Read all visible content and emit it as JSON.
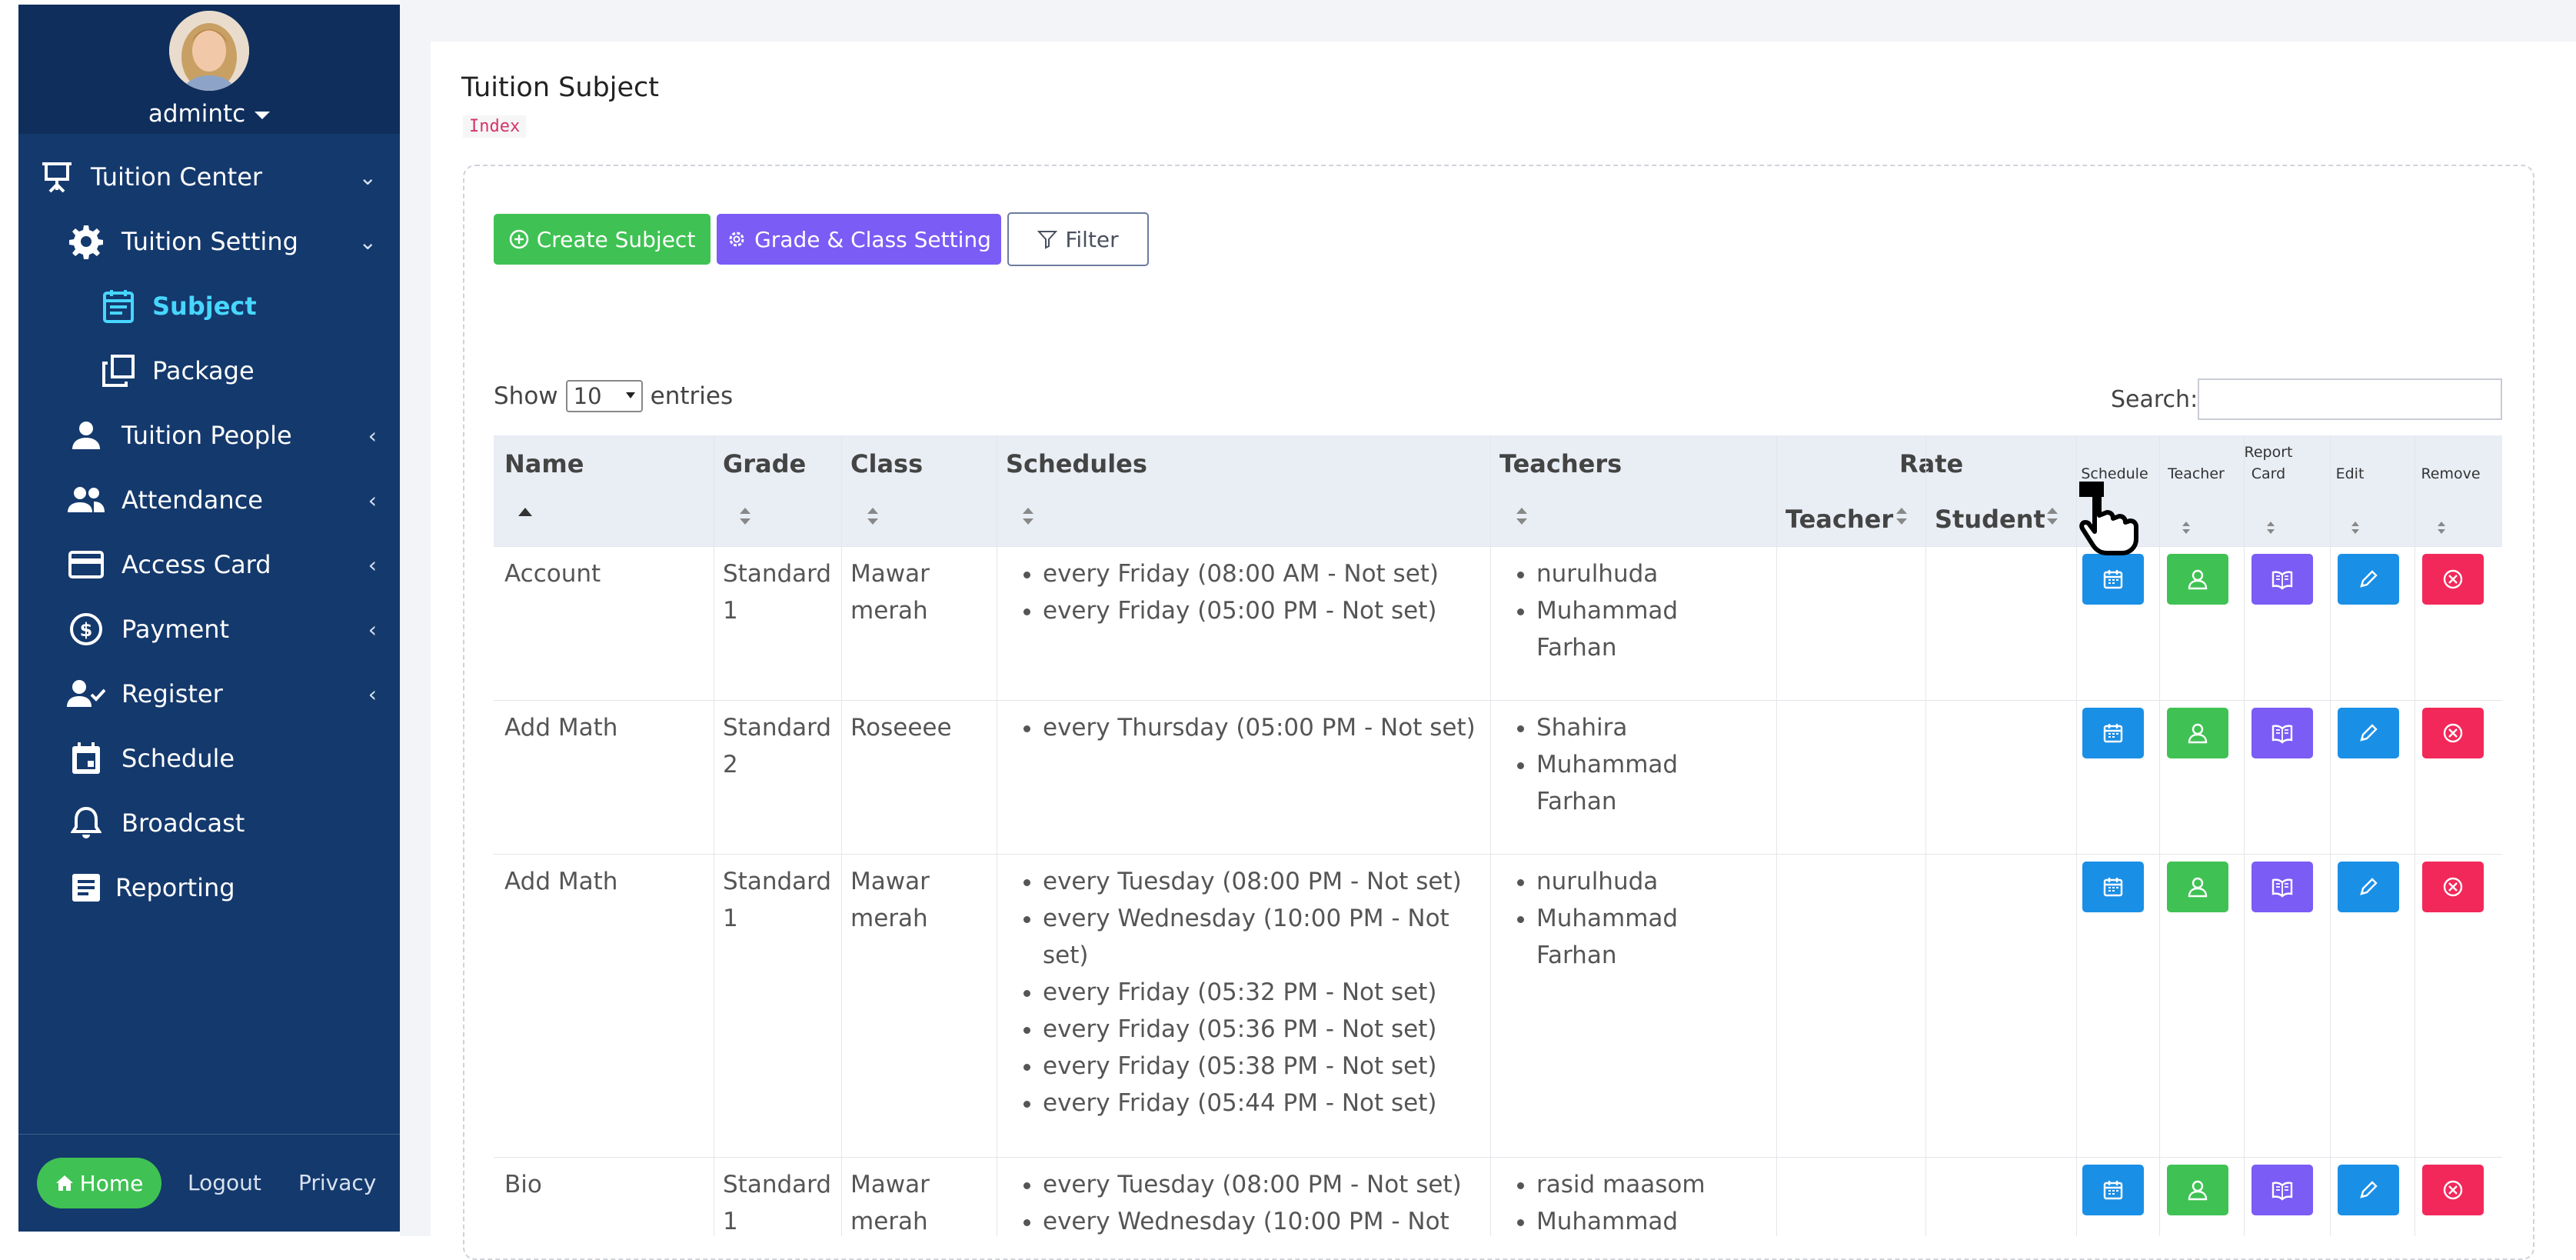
{
  "user": {
    "name": "admintc"
  },
  "sidebar": {
    "items": [
      {
        "label": "Tuition Center",
        "icon": "presentation-board-icon",
        "arrow": "expanded"
      },
      {
        "label": "Tuition Setting",
        "icon": "gear-icon",
        "arrow": "expanded"
      },
      {
        "label": "Subject",
        "icon": "calendar-note-icon",
        "active": true
      },
      {
        "label": "Package",
        "icon": "copy-stack-icon"
      },
      {
        "label": "Tuition People",
        "icon": "person-icon",
        "arrow": "collapsed"
      },
      {
        "label": "Attendance",
        "icon": "people-group-icon",
        "arrow": "collapsed"
      },
      {
        "label": "Access Card",
        "icon": "credit-card-icon",
        "arrow": "collapsed"
      },
      {
        "label": "Payment",
        "icon": "dollar-circle-icon",
        "arrow": "collapsed"
      },
      {
        "label": "Register",
        "icon": "person-check-icon",
        "arrow": "collapsed"
      },
      {
        "label": "Schedule",
        "icon": "calendar-icon"
      },
      {
        "label": "Broadcast",
        "icon": "bell-icon"
      },
      {
        "label": "Reporting",
        "icon": "document-icon"
      }
    ],
    "footer": {
      "home": "Home",
      "logout": "Logout",
      "privacy": "Privacy"
    }
  },
  "page": {
    "title": "Tuition Subject",
    "breadcrumb": "Index"
  },
  "toolbar": {
    "create": "Create Subject",
    "grade": "Grade & Class Setting",
    "filter": "Filter"
  },
  "table_controls": {
    "show": "Show",
    "entries_value": "10",
    "entries": "entries",
    "search": "Search:"
  },
  "table": {
    "headers": {
      "name": "Name",
      "grade": "Grade",
      "class": "Class",
      "schedules": "Schedules",
      "teachers": "Teachers",
      "rate": "Rate",
      "rate_teacher": "Teacher",
      "rate_student": "Student",
      "a_schedule": "Schedule",
      "a_teacher": "Teacher",
      "a_report_1": "Report",
      "a_report_2": "Card",
      "a_edit": "Edit",
      "a_remove": "Remove"
    },
    "rows": [
      {
        "name": "Account",
        "grade_1": "Standard",
        "grade_2": "1",
        "class_1": "Mawar",
        "class_2": "merah",
        "schedules": [
          "every Friday (08:00 AM - Not set)",
          "every Friday (05:00 PM - Not set)"
        ],
        "teachers": [
          "nurulhuda",
          "Muhammad",
          "Farhan"
        ]
      },
      {
        "name": "Add Math",
        "grade_1": "Standard",
        "grade_2": "2",
        "class_1": "Roseeee",
        "class_2": "",
        "schedules": [
          "every Thursday (05:00 PM - Not set)"
        ],
        "teachers": [
          "Shahira",
          "Muhammad",
          "Farhan"
        ]
      },
      {
        "name": "Add Math",
        "grade_1": "Standard",
        "grade_2": "1",
        "class_1": "Mawar",
        "class_2": "merah",
        "schedules": [
          "every Tuesday (08:00 PM - Not set)",
          "every Wednesday (10:00 PM - Not",
          "set)",
          "every Friday (05:32 PM - Not set)",
          "every Friday (05:36 PM - Not set)",
          "every Friday (05:38 PM - Not set)",
          "every Friday (05:44 PM - Not set)"
        ],
        "teachers": [
          "nurulhuda",
          "Muhammad",
          "Farhan"
        ]
      },
      {
        "name": "Bio",
        "grade_1": "Standard",
        "grade_2": "1",
        "class_1": "Mawar",
        "class_2": "merah",
        "schedules": [
          "every Tuesday (08:00 PM - Not set)",
          "every Wednesday (10:00 PM - Not"
        ],
        "teachers": [
          "rasid maasom",
          "Muhammad"
        ]
      }
    ]
  },
  "colors": {
    "sidebar": "#14396d",
    "active": "#47d6ff",
    "green": "#3fc253",
    "purple": "#7b5cf5",
    "blue": "#1a8fe6",
    "red": "#f2285a"
  }
}
